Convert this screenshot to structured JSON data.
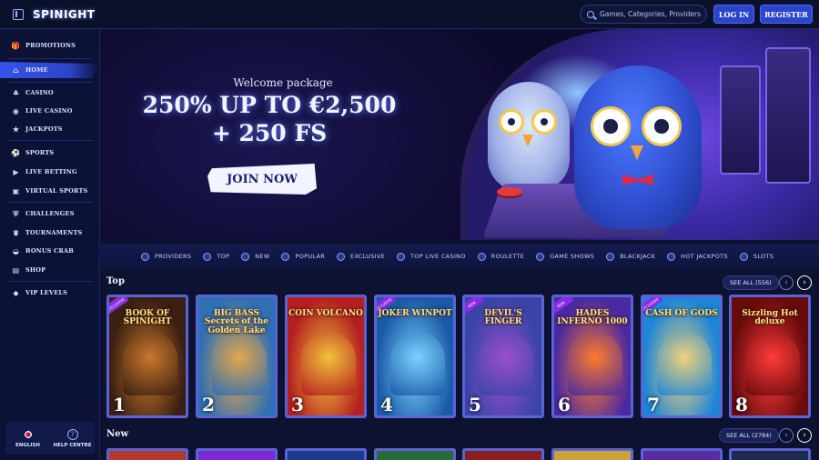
{
  "header": {
    "logo": "SPINIGHT",
    "search_placeholder": "Games, Categories, Providers",
    "login_label": "LOG IN",
    "register_label": "REGISTER"
  },
  "sidebar": {
    "items": [
      {
        "label": "PROMOTIONS",
        "icon": "gift-icon"
      },
      {
        "label": "HOME",
        "icon": "home-icon",
        "active": true
      },
      {
        "label": "CASINO",
        "icon": "casino-icon"
      },
      {
        "label": "LIVE CASINO",
        "icon": "live-casino-icon"
      },
      {
        "label": "JACKPOTS",
        "icon": "jackpot-icon"
      },
      {
        "label": "SPORTS",
        "icon": "sports-icon"
      },
      {
        "label": "LIVE BETTING",
        "icon": "live-betting-icon"
      },
      {
        "label": "VIRTUAL SPORTS",
        "icon": "virtual-sports-icon"
      },
      {
        "label": "CHALLENGES",
        "icon": "challenges-icon"
      },
      {
        "label": "TOURNAMENTS",
        "icon": "trophy-icon"
      },
      {
        "label": "BONUS CRAB",
        "icon": "bonus-crab-icon"
      },
      {
        "label": "SHOP",
        "icon": "shop-icon"
      },
      {
        "label": "VIP LEVELS",
        "icon": "diamond-icon"
      }
    ],
    "language_label": "ENGLISH",
    "help_label": "HELP CENTRE"
  },
  "hero": {
    "subtitle": "Welcome package",
    "title_line1": "250% UP TO €2,500",
    "title_line2": "+ 250 FS",
    "cta_label": "JOIN NOW"
  },
  "categories": [
    "PROVIDERS",
    "TOP",
    "NEW",
    "POPULAR",
    "EXCLUSIVE",
    "TOP LIVE CASINO",
    "ROULETTE",
    "GAME SHOWS",
    "BLACKJACK",
    "HOT JACKPOTS",
    "SLOTS"
  ],
  "top_section": {
    "title": "Top",
    "see_all": "SEE ALL (556)",
    "games": [
      {
        "name": "BOOK OF SPINIGHT",
        "rank": "1",
        "badge": "EXCLUSIVE",
        "bg": "#3a1f12",
        "accent": "#c9772a"
      },
      {
        "name": "BIG BASS Secrets of the Golden Lake",
        "rank": "2",
        "badge": "",
        "bg": "#2f6fb3",
        "accent": "#e4a64a"
      },
      {
        "name": "COIN VOLCANO",
        "rank": "3",
        "badge": "",
        "bg": "#b51f1f",
        "accent": "#f0c23a"
      },
      {
        "name": "JOKER WINPOT",
        "rank": "4",
        "badge": "EXCLUSIVE",
        "bg": "#1b5aa8",
        "accent": "#7ad3ff"
      },
      {
        "name": "DEVIL'S FINGER",
        "rank": "5",
        "badge": "NEW",
        "bg": "#3a44a8",
        "accent": "#9b4fc9"
      },
      {
        "name": "HADES INFERNO 1000",
        "rank": "6",
        "badge": "NEW",
        "bg": "#4a2aa0",
        "accent": "#ff7a2a"
      },
      {
        "name": "CASH OF GODS",
        "rank": "7",
        "badge": "EXCLUSIVE",
        "bg": "#1e86d6",
        "accent": "#f0d27a"
      },
      {
        "name": "Sizzling Hot deluxe",
        "rank": "8",
        "badge": "",
        "bg": "#6a0b0b",
        "accent": "#ff3a3a"
      }
    ]
  },
  "new_section": {
    "title": "New",
    "see_all": "SEE ALL (2784)"
  },
  "colors": {
    "accent": "#2a45c9",
    "background": "#0d1230",
    "tile_border": "#5a63d6"
  }
}
